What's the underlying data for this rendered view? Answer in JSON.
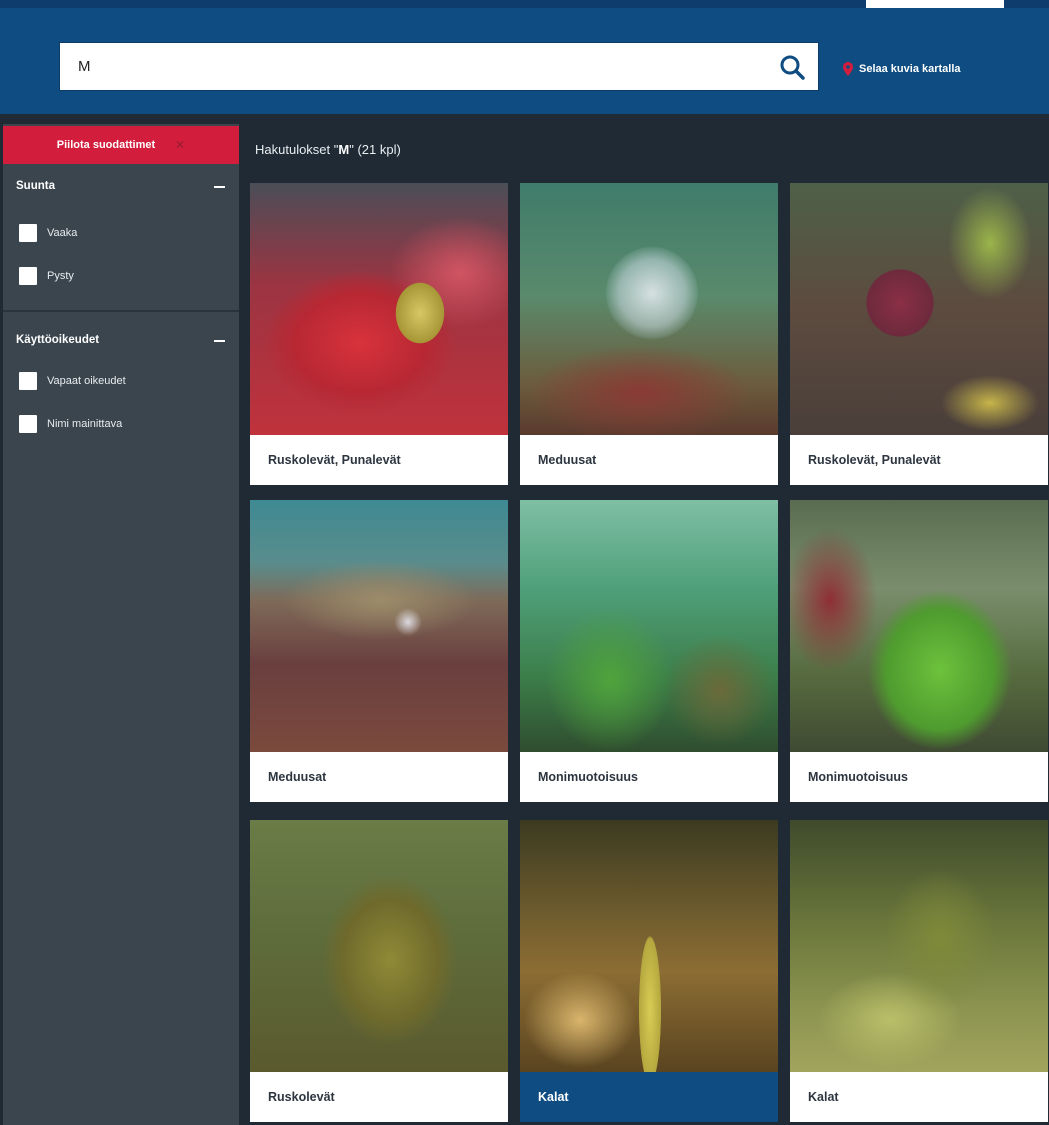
{
  "search": {
    "value": "M",
    "placeholder": ""
  },
  "header": {
    "map_link": "Selaa kuvia kartalla"
  },
  "sidebar": {
    "hide_filters_label": "Piilota suodattimet",
    "sections": [
      {
        "title": "Suunta",
        "options": [
          "Vaaka",
          "Pysty"
        ]
      },
      {
        "title": "Käyttöoikeudet",
        "options": [
          "Vapaat oikeudet",
          "Nimi mainittava"
        ]
      }
    ]
  },
  "results": {
    "prefix": "Hakutulokset \"",
    "query": "M",
    "suffix": "\" (21 kpl)",
    "cards": [
      {
        "caption": "Ruskolevät, Punalevät"
      },
      {
        "caption": "Meduusat"
      },
      {
        "caption": "Ruskolevät, Punalevät"
      },
      {
        "caption": "Meduusat"
      },
      {
        "caption": "Monimuotoisuus"
      },
      {
        "caption": "Monimuotoisuus"
      },
      {
        "caption": "Ruskolevät"
      },
      {
        "caption": "Kalat",
        "active": true
      },
      {
        "caption": "Kalat"
      }
    ]
  },
  "colors": {
    "header": "#0e4c82",
    "sidebar": "#3a454e",
    "accent": "#d21e3c",
    "background": "#1f2a34",
    "active_caption": "#0e4c82"
  },
  "icons": {
    "search": "search-icon",
    "map": "map-pin-icon",
    "close": "close-icon",
    "collapse": "minus-icon"
  }
}
